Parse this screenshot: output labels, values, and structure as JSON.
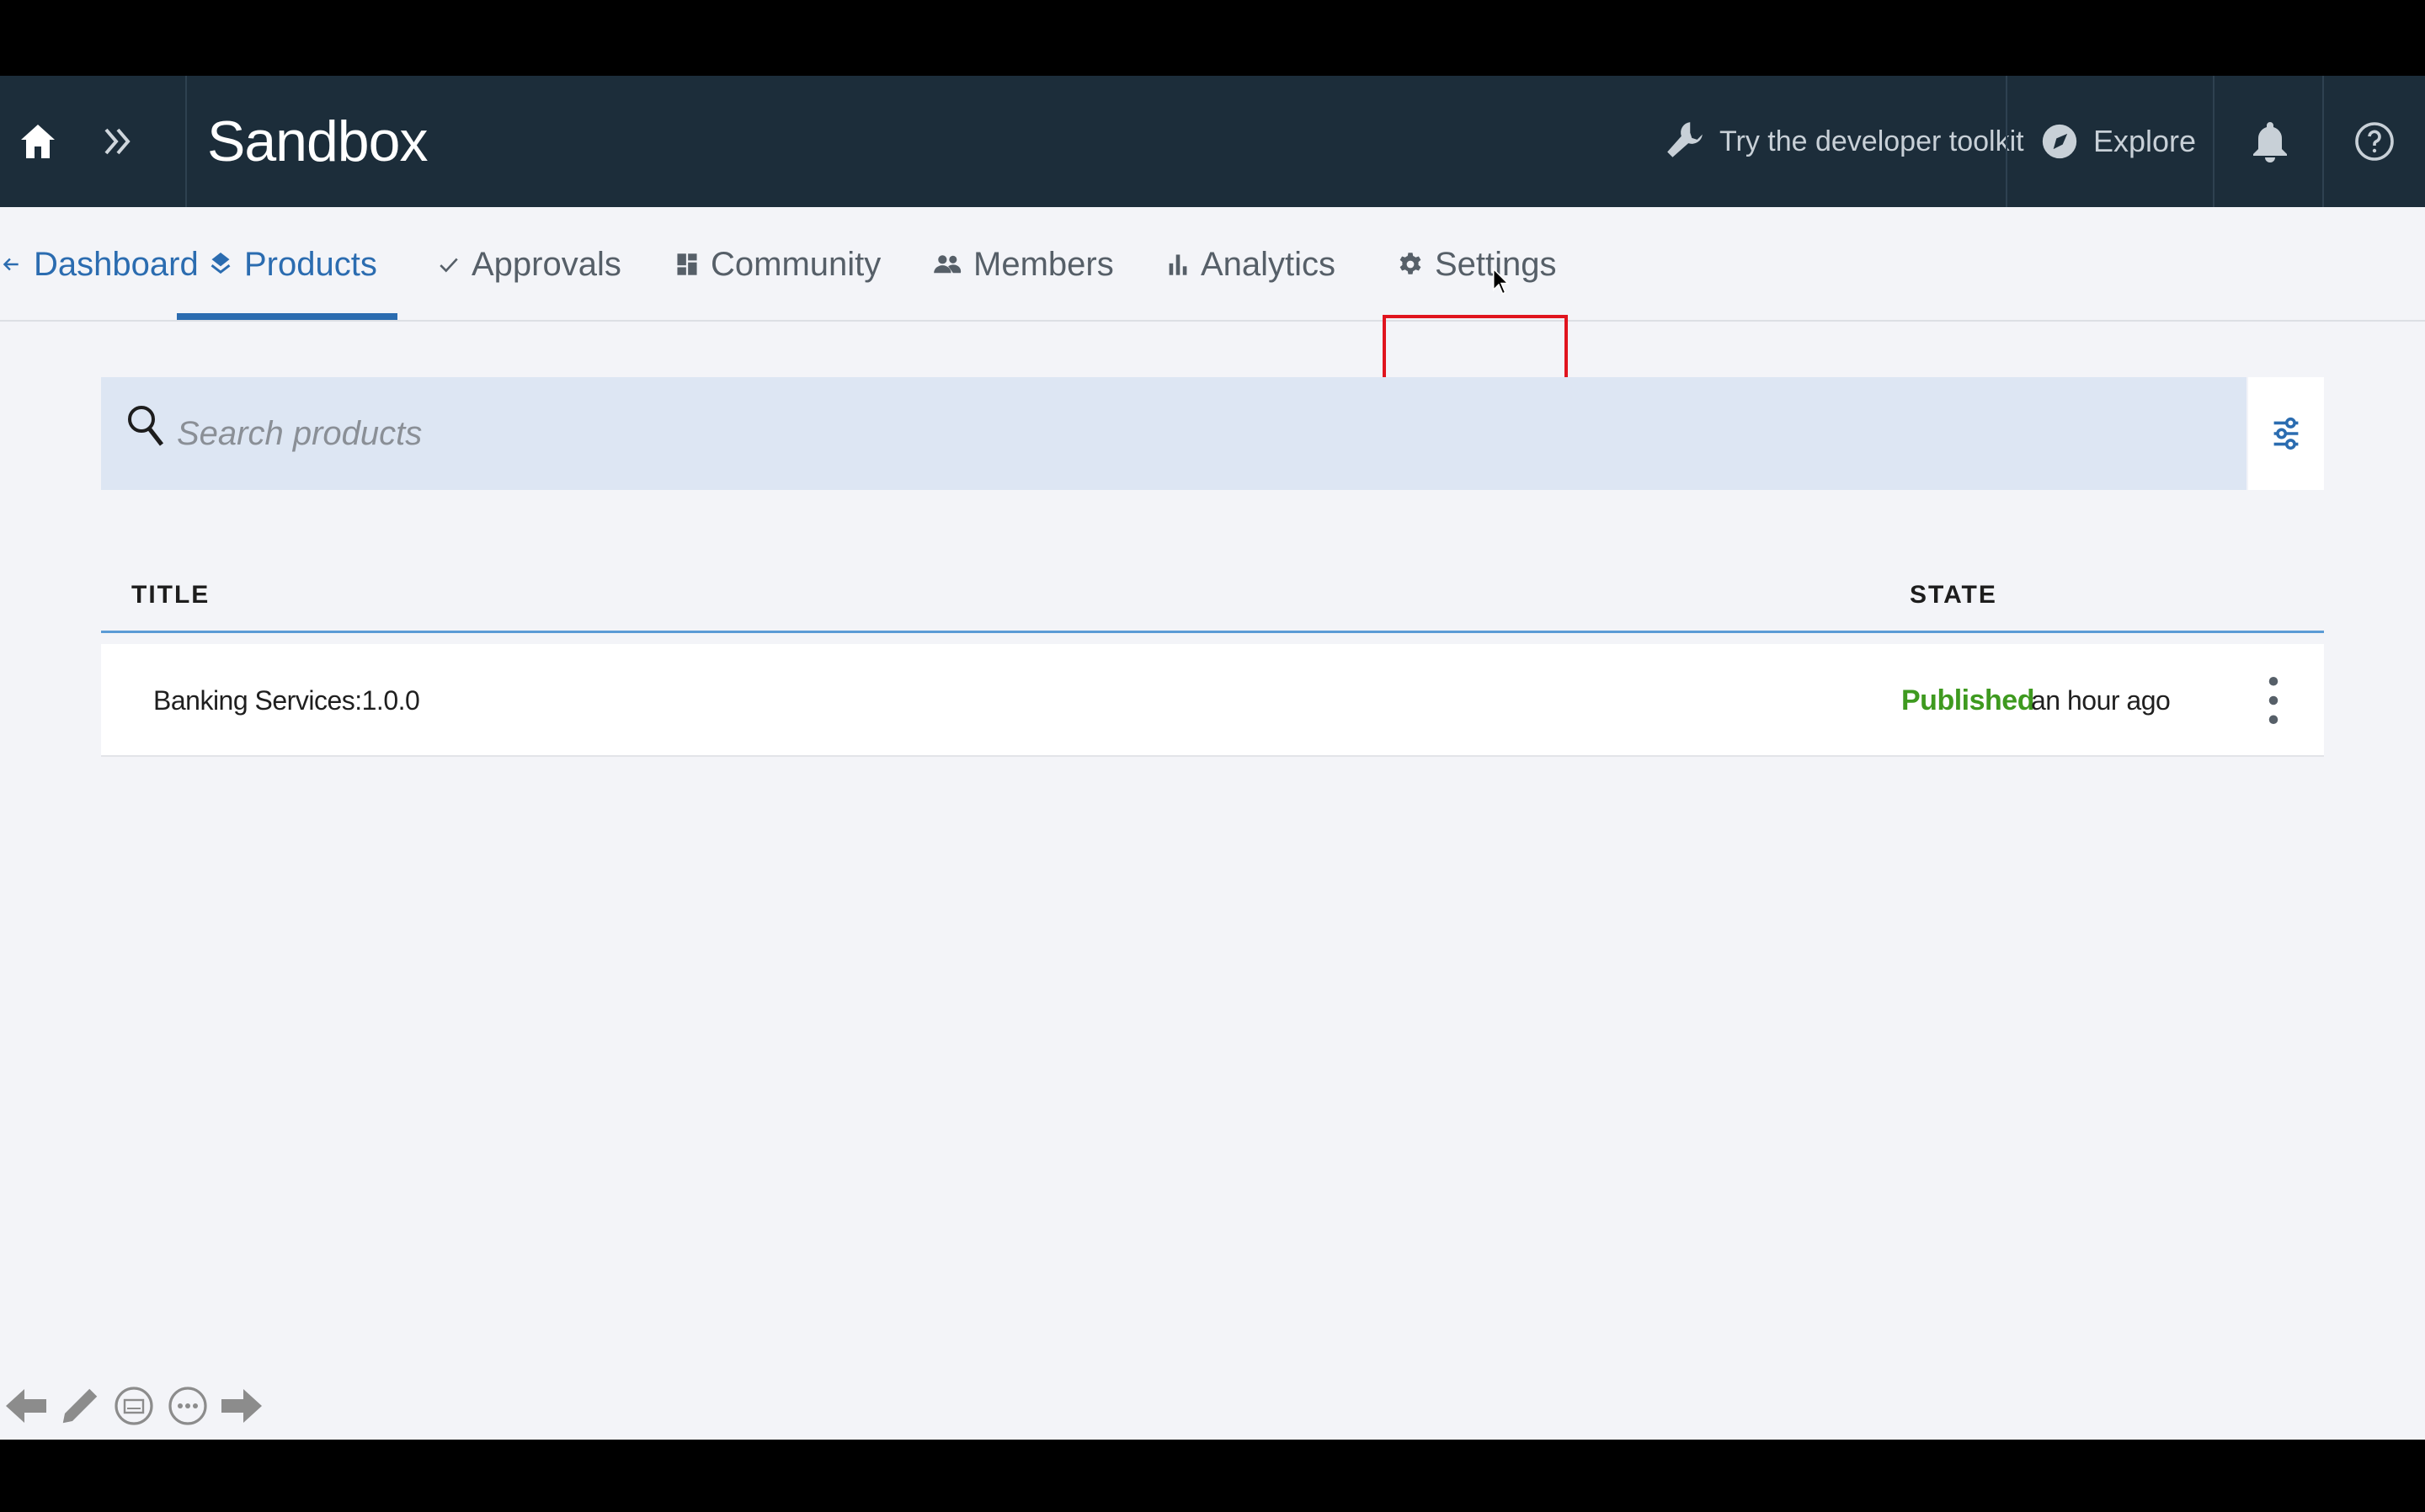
{
  "header": {
    "title": "Sandbox",
    "toolkit_label": "Try the developer toolkit",
    "explore_label": "Explore"
  },
  "tabs": [
    {
      "label": "Dashboard",
      "icon": "arrow-left-icon",
      "state": "back"
    },
    {
      "label": "Products",
      "icon": "products-icon",
      "state": "active"
    },
    {
      "label": "Approvals",
      "icon": "checkmark-icon",
      "state": "normal"
    },
    {
      "label": "Community",
      "icon": "community-icon",
      "state": "normal"
    },
    {
      "label": "Members",
      "icon": "members-icon",
      "state": "normal"
    },
    {
      "label": "Analytics",
      "icon": "analytics-icon",
      "state": "normal"
    },
    {
      "label": "Settings",
      "icon": "gear-icon",
      "state": "highlighted"
    }
  ],
  "search": {
    "placeholder": "Search products",
    "value": ""
  },
  "table": {
    "columns": [
      "TITLE",
      "STATE"
    ],
    "rows": [
      {
        "title": "Banking Services:1.0.0",
        "state": "Published",
        "updated": "an hour ago"
      }
    ]
  },
  "colors": {
    "header_bg": "#1c2d3a",
    "accent": "#2b6cb0",
    "published": "#3e9a1f",
    "highlight": "#e0141e",
    "search_bg": "#dde6f3",
    "page_bg": "#f3f4f8"
  }
}
